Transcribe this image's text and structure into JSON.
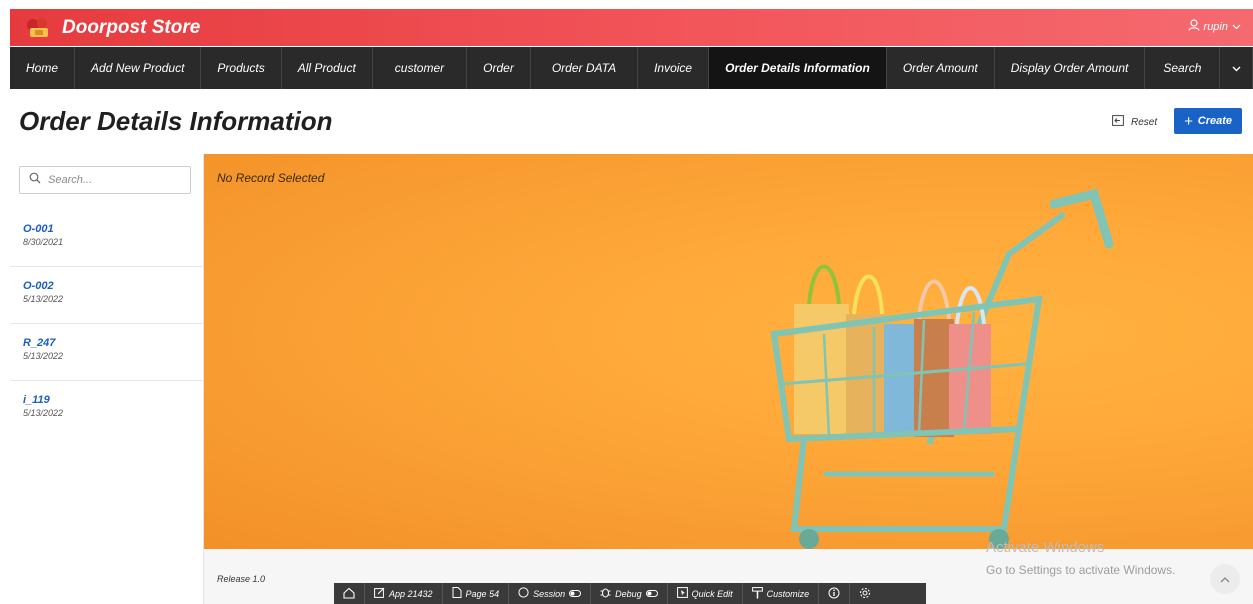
{
  "header": {
    "app_title": "Doorpost Store",
    "user_name": "rupin"
  },
  "nav": {
    "items": [
      {
        "label": "Home"
      },
      {
        "label": "Add New Product"
      },
      {
        "label": "Products"
      },
      {
        "label": "All Product"
      },
      {
        "label": "customer"
      },
      {
        "label": "Order"
      },
      {
        "label": "Order DATA"
      },
      {
        "label": "Invoice"
      },
      {
        "label": "Order Details Information",
        "active": true
      },
      {
        "label": "Order Amount"
      },
      {
        "label": "Display Order Amount"
      },
      {
        "label": "Search"
      }
    ]
  },
  "page": {
    "title": "Order Details Information",
    "reset_label": "Reset",
    "create_label": "Create"
  },
  "search": {
    "placeholder": "Search..."
  },
  "records": [
    {
      "id": "O-001",
      "date": "8/30/2021"
    },
    {
      "id": "O-002",
      "date": "5/13/2022"
    },
    {
      "id": "R_247",
      "date": "5/13/2022"
    },
    {
      "id": "i_119",
      "date": "5/13/2022"
    }
  ],
  "main": {
    "no_record_text": "No Record Selected"
  },
  "footer": {
    "release": "Release 1.0",
    "watermark_title": "Activate Windows",
    "watermark_sub": "Go to Settings to activate Windows."
  },
  "devbar": {
    "app": "App 21432",
    "page": "Page 54",
    "session": "Session",
    "debug": "Debug",
    "quick_edit": "Quick Edit",
    "customize": "Customize"
  },
  "colors": {
    "brand": "#e63b3e",
    "nav_bg": "#2a2a2a",
    "accent": "#1a63c6",
    "banner": "#ffa93a"
  }
}
